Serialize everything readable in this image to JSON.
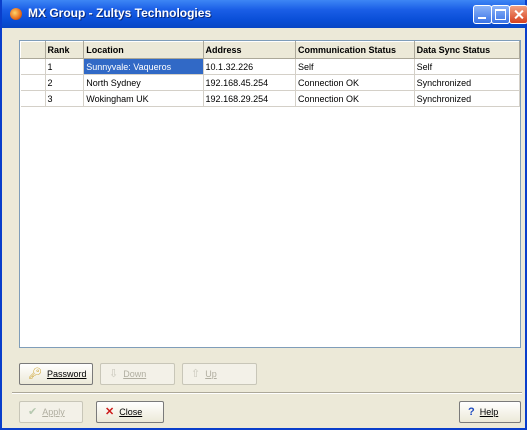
{
  "window": {
    "title": "MX Group - Zultys Technologies"
  },
  "table": {
    "headers": [
      "",
      "Rank",
      "Location",
      "Address",
      "Communication Status",
      "Data Sync Status"
    ],
    "rows": [
      {
        "rank": "1",
        "location": "Sunnyvale: Vaqueros",
        "address": "10.1.32.226",
        "comm_status": "Self",
        "sync_status": "Self"
      },
      {
        "rank": "2",
        "location": "North Sydney",
        "address": "192.168.45.254",
        "comm_status": "Connection OK",
        "sync_status": "Synchronized"
      },
      {
        "rank": "3",
        "location": "Wokingham UK",
        "address": "192.168.29.254",
        "comm_status": "Connection OK",
        "sync_status": "Synchronized"
      }
    ]
  },
  "buttons": {
    "password": "Password",
    "down": "Down",
    "up": "Up",
    "apply": "Apply",
    "close": "Close",
    "help": "Help"
  },
  "icons": {
    "app": "app-icon",
    "key": "key-icon",
    "down": "arrow-down-icon",
    "up": "arrow-up-icon",
    "apply": "checkmark-icon",
    "close": "close-x-icon",
    "help": "help-icon"
  }
}
